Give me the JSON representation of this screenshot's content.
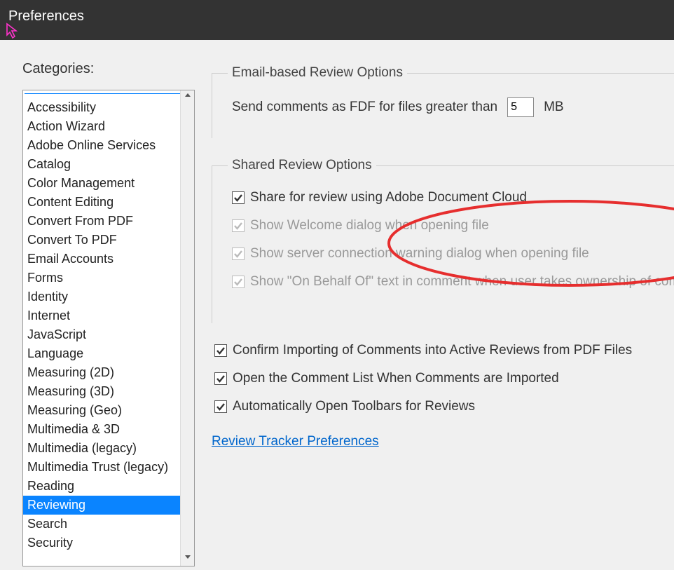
{
  "window": {
    "title": "Preferences"
  },
  "sidebar": {
    "label": "Categories:",
    "items": [
      "Accessibility",
      "Action Wizard",
      "Adobe Online Services",
      "Catalog",
      "Color Management",
      "Content Editing",
      "Convert From PDF",
      "Convert To PDF",
      "Email Accounts",
      "Forms",
      "Identity",
      "Internet",
      "JavaScript",
      "Language",
      "Measuring (2D)",
      "Measuring (3D)",
      "Measuring (Geo)",
      "Multimedia & 3D",
      "Multimedia (legacy)",
      "Multimedia Trust (legacy)",
      "Reading",
      "Reviewing",
      "Search",
      "Security"
    ],
    "selected_index": 21
  },
  "email_group": {
    "legend": "Email-based Review Options",
    "row_label": "Send comments as FDF for files greater than",
    "value": "5",
    "unit": "MB"
  },
  "shared_group": {
    "legend": "Shared Review Options",
    "items": [
      {
        "label": "Share for review using Adobe Document Cloud",
        "checked": true,
        "enabled": true
      },
      {
        "label": "Show Welcome dialog when opening file",
        "checked": true,
        "enabled": false
      },
      {
        "label": "Show server connection warning dialog when opening file",
        "checked": true,
        "enabled": false
      },
      {
        "label": "Show \"On Behalf Of\" text in comment when user takes ownership of commen",
        "checked": true,
        "enabled": false
      }
    ]
  },
  "free_checks": [
    {
      "label": "Confirm Importing of Comments into Active Reviews from PDF Files",
      "checked": true
    },
    {
      "label": "Open the Comment List When Comments are Imported",
      "checked": true
    },
    {
      "label": "Automatically Open Toolbars for Reviews",
      "checked": true
    }
  ],
  "link": {
    "label": "Review Tracker Preferences"
  }
}
